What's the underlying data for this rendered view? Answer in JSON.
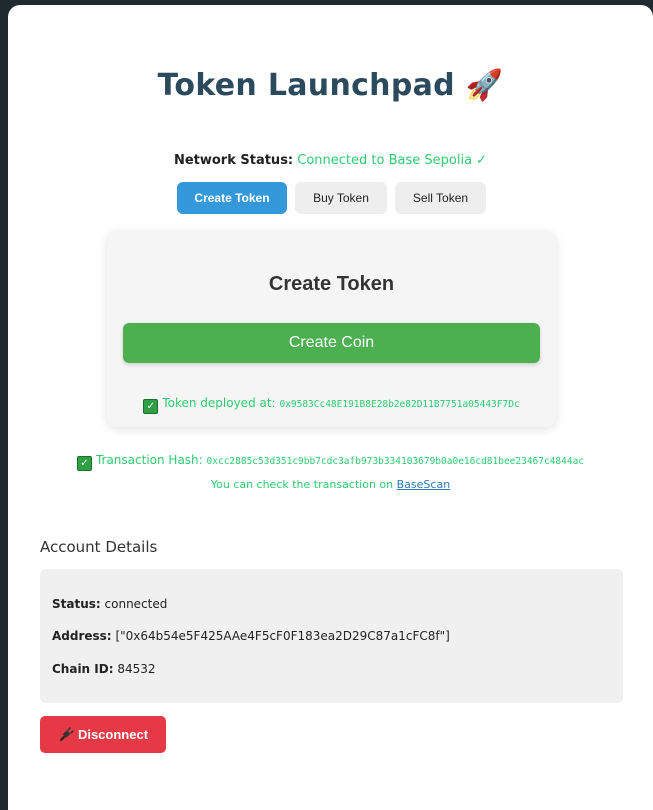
{
  "app": {
    "title": "Token Launchpad",
    "title_emoji": "🚀"
  },
  "network": {
    "label": "Network Status:",
    "value": "Connected to Base Sepolia ✓"
  },
  "tabs": [
    {
      "label": "Create Token",
      "active": true
    },
    {
      "label": "Buy Token",
      "active": false
    },
    {
      "label": "Sell Token",
      "active": false
    }
  ],
  "panel": {
    "heading": "Create Token",
    "button_label": "Create Coin",
    "deployed_label": "Token deployed at:",
    "deployed_address": "0x9583Cc48E191B8E28b2e82D11B7751a05443F7Dc"
  },
  "transaction": {
    "label": "Transaction Hash:",
    "hash": "0xcc2885c53d351c9bb7cdc3afb973b334103679b0a0e16cd81bee23467c4844ac",
    "check_text": "You can check the transaction on",
    "link_text": "BaseScan"
  },
  "account": {
    "title": "Account Details",
    "status_label": "Status:",
    "status_value": "connected",
    "address_label": "Address:",
    "address_value": "[\"0x64b54e5F425AAe4F5cF0F183ea2D29C87a1cFC8f\"]",
    "chain_label": "Chain ID:",
    "chain_value": "84532"
  },
  "disconnect": {
    "label": "Disconnect",
    "icon": "unplug-icon"
  },
  "colors": {
    "accent": "#3498db",
    "success": "#2ecc71",
    "create_button": "#4caf50",
    "danger": "#e63946",
    "title": "#2c4a5e"
  }
}
